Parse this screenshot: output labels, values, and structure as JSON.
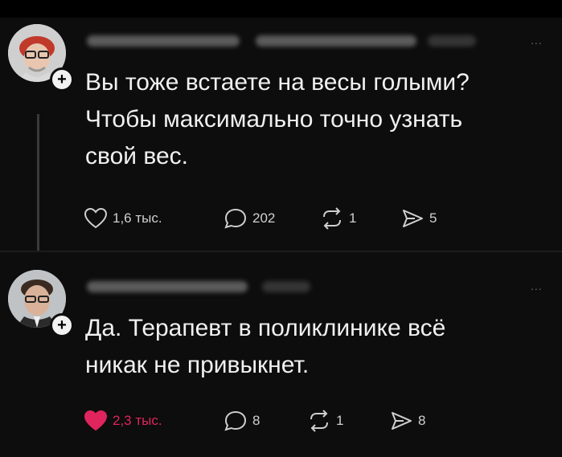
{
  "posts": [
    {
      "text_lines": [
        "Вы тоже встаете на весы голыми?",
        "Чтобы максимально точно узнать",
        "свой вес."
      ],
      "likes": "1,6 тыс.",
      "comments": "202",
      "reposts": "1",
      "shares": "5",
      "liked": false,
      "more": "..."
    },
    {
      "text_lines": [
        "Да. Терапевт в поликлинике всё",
        "никак не привыкнет."
      ],
      "likes": "2,3 тыс.",
      "comments": "8",
      "reposts": "1",
      "shares": "8",
      "liked": true,
      "more": "..."
    }
  ],
  "follow_badge_symbol": "+",
  "colors": {
    "background": "#000000",
    "card": "#0d0d0d",
    "text": "#f0f0f0",
    "like_active": "#e0245e",
    "icon": "#cfcfcf"
  },
  "icons": [
    "heart-icon",
    "comment-icon",
    "repost-icon",
    "share-icon",
    "more-icon",
    "follow-plus-icon"
  ]
}
